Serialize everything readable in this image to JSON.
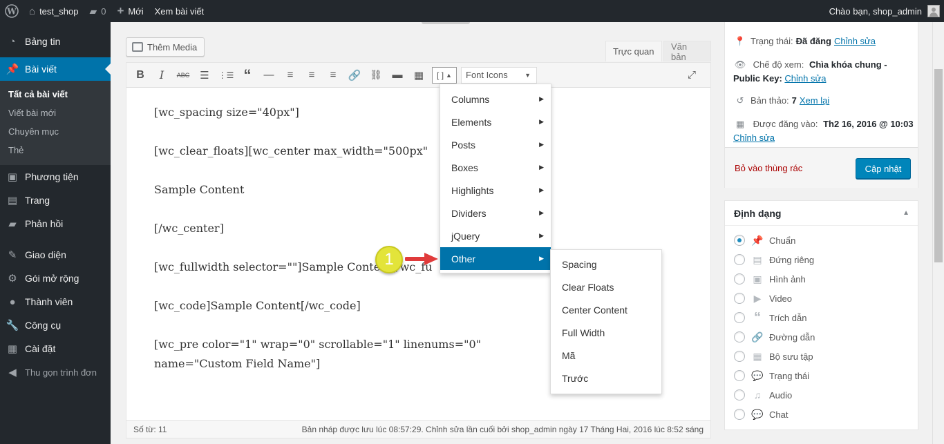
{
  "adminbar": {
    "site_name": "test_shop",
    "comments_count": "0",
    "new_label": "Mới",
    "view_post": "Xem bài viết",
    "greeting": "Chào bạn, shop_admin"
  },
  "menu": {
    "dashboard": "Bảng tin",
    "posts": "Bài viết",
    "posts_sub": [
      "Tất cả bài viết",
      "Viết bài mới",
      "Chuyên mục",
      "Thẻ"
    ],
    "media": "Phương tiện",
    "pages": "Trang",
    "comments": "Phản hồi",
    "appearance": "Giao diện",
    "plugins": "Gói mở rộng",
    "users": "Thành viên",
    "tools": "Công cụ",
    "settings": "Cài đặt",
    "collapse": "Thu gọn trình đơn"
  },
  "editor": {
    "add_media": "Thêm Media",
    "tab_visual": "Trực quan",
    "tab_text": "Văn bản",
    "shortcode_btn": "[ ]",
    "font_icons": "Font Icons",
    "lines": [
      "[wc_spacing size=\"40px\"]",
      "[wc_clear_floats][wc_center max_width=\"500px\"",
      "Sample Content",
      "[/wc_center]",
      "[wc_fullwidth selector=\"\"]Sample Content[/wc_fu",
      "[wc_code]Sample Content[/wc_code]",
      "[wc_pre color=\"1\" wrap=\"0\" scrollable=\"1\" linenums=\"0\" name=\"Custom Field Name\"]"
    ],
    "word_count": "Số từ: 11",
    "draft_status": "Bản nháp được lưu lúc 08:57:29. Chỉnh sửa lần cuối bởi shop_admin ngày 17 Tháng Hai, 2016 lúc 8:52 sáng"
  },
  "dropdown": {
    "items": [
      "Columns",
      "Elements",
      "Posts",
      "Boxes",
      "Highlights",
      "Dividers",
      "jQuery",
      "Other"
    ],
    "submenu": [
      "Spacing",
      "Clear Floats",
      "Center Content",
      "Full Width",
      "Mã",
      "Trước"
    ]
  },
  "annotation": {
    "step": "1"
  },
  "publish": {
    "status_label": "Trạng thái:",
    "status_value": "Đã đăng",
    "edit": "Chỉnh sửa",
    "visibility_label": "Chế độ xem:",
    "visibility_value": "Chìa khóa chung - Public Key:",
    "revisions_label": "Bản thảo:",
    "revisions_value": "7",
    "revisions_link": "Xem lại",
    "published_label": "Được đăng vào:",
    "published_value": "Th2 16, 2016 @ 10:03",
    "trash": "Bỏ vào thùng rác",
    "update": "Cập nhật"
  },
  "format": {
    "title": "Định dạng",
    "options": [
      "Chuẩn",
      "Đứng riêng",
      "Hình ảnh",
      "Video",
      "Trích dẫn",
      "Đường dẫn",
      "Bộ sưu tập",
      "Trạng thái",
      "Audio",
      "Chat"
    ]
  }
}
